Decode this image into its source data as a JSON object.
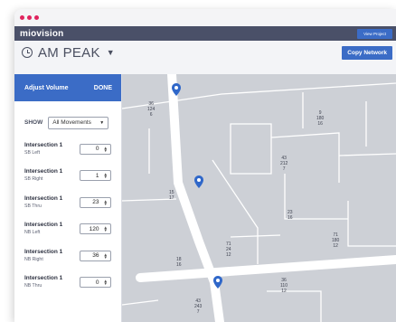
{
  "app": {
    "brand": "miovision",
    "view_project_label": "View Project"
  },
  "header": {
    "period_label": "AM PEAK",
    "copy_network_label": "Copy Network"
  },
  "panel": {
    "title": "Adjust Volume",
    "done_label": "DONE",
    "show_label": "SHOW",
    "show_value": "All Movements",
    "rows": [
      {
        "title": "Intersection 1",
        "movement": "SB Left",
        "value": "0"
      },
      {
        "title": "Intersection 1",
        "movement": "SB Right",
        "value": "1"
      },
      {
        "title": "Intersection 1",
        "movement": "SB Thru",
        "value": "23"
      },
      {
        "title": "Intersection 1",
        "movement": "NB Left",
        "value": "120"
      },
      {
        "title": "Intersection 1",
        "movement": "NB Right",
        "value": "36"
      },
      {
        "title": "Intersection 1",
        "movement": "NB Thru",
        "value": "0"
      }
    ]
  },
  "map": {
    "counts": [
      "36\n124\n6",
      "9\n180\n16",
      "43\n212\n7",
      "15\n17",
      "71\n180\n12",
      "71\n24\n12",
      "36\n110\n12",
      "43\n243\n7",
      "23\n16",
      "18\n16"
    ]
  },
  "colors": {
    "accent": "#3b6cc6",
    "appbar": "#4a5068",
    "map_bg": "#cdd0d6",
    "road": "#ffffff",
    "pin": "#2f67c9"
  }
}
